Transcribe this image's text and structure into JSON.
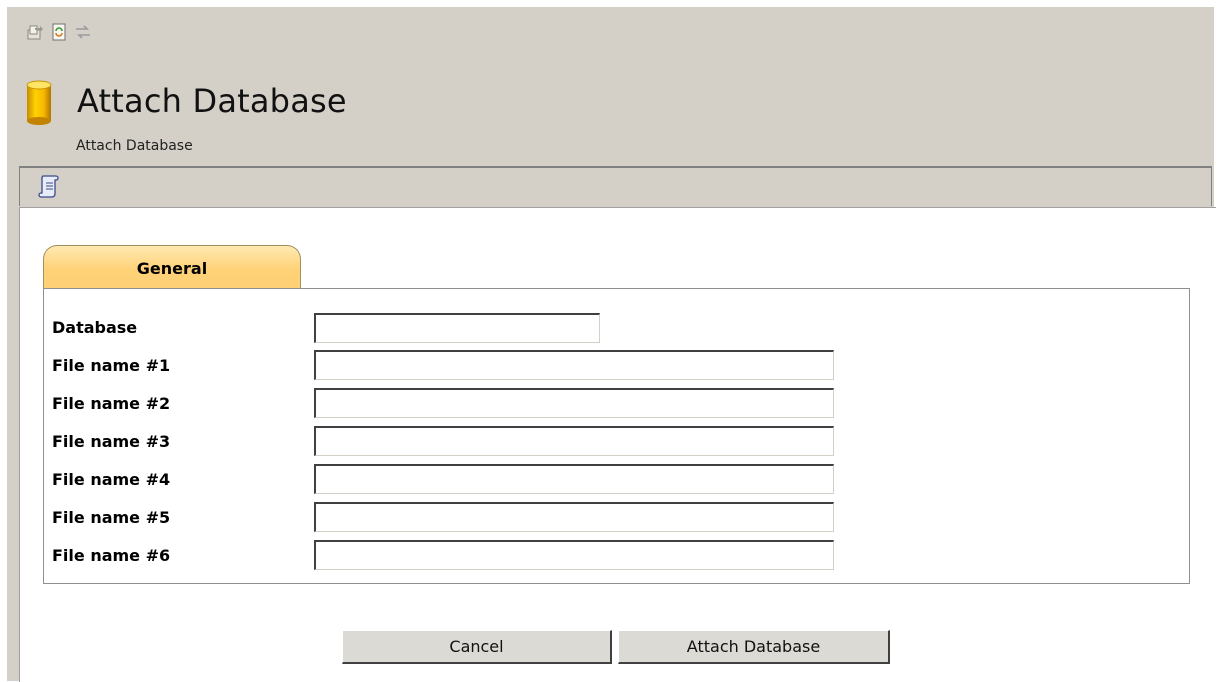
{
  "header": {
    "title": "Attach Database",
    "subtitle": "Attach Database",
    "toolbar_icons": [
      "export-icon",
      "refresh-icon",
      "swap-icon"
    ],
    "script_icon": "script-icon"
  },
  "tabs": [
    {
      "label": "General",
      "active": true
    }
  ],
  "form": {
    "fields": [
      {
        "label": "Database",
        "value": ""
      },
      {
        "label": "File name #1",
        "value": ""
      },
      {
        "label": "File name #2",
        "value": ""
      },
      {
        "label": "File name #3",
        "value": ""
      },
      {
        "label": "File name #4",
        "value": ""
      },
      {
        "label": "File name #5",
        "value": ""
      },
      {
        "label": "File name #6",
        "value": ""
      }
    ]
  },
  "actions": {
    "cancel_label": "Cancel",
    "attach_label": "Attach Database"
  },
  "colors": {
    "chrome": "#d4d0c8",
    "tab_top": "#ffe9b0",
    "tab_bottom": "#ffd074",
    "db_icon": "#f0b400"
  }
}
